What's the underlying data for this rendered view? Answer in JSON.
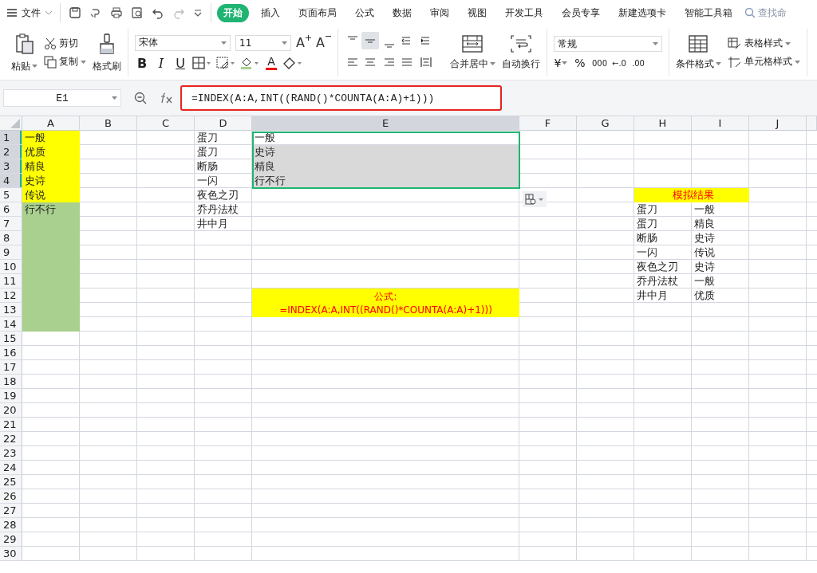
{
  "menu_bar": {
    "file": "文件",
    "tabs": [
      {
        "label": "开始",
        "selected": true
      },
      {
        "label": "插入",
        "selected": false
      },
      {
        "label": "页面布局",
        "selected": false
      },
      {
        "label": "公式",
        "selected": false
      },
      {
        "label": "数据",
        "selected": false
      },
      {
        "label": "审阅",
        "selected": false
      },
      {
        "label": "视图",
        "selected": false
      },
      {
        "label": "开发工具",
        "selected": false
      },
      {
        "label": "会员专享",
        "selected": false
      },
      {
        "label": "新建选项卡",
        "selected": false
      },
      {
        "label": "智能工具箱",
        "selected": false
      }
    ],
    "search": "查找命"
  },
  "ribbon": {
    "paste": "粘贴",
    "cut": "剪切",
    "copy": "复制",
    "format_painter": "格式刷",
    "font": "宋体",
    "size": "11",
    "grow_font": "A",
    "shrink_font": "A",
    "bold": "B",
    "italic": "I",
    "underline": "U",
    "font_color": "A",
    "merge_center": "合并居中",
    "wrap_text": "自动换行",
    "number_format": "常规",
    "currency": "¥",
    "percent": "%",
    "thousands": "000",
    "decimal_increase": "←.0",
    "decimal_decrease": ".00",
    "conditional_format": "条件格式",
    "table_style": "表格样式",
    "cell_style": "单元格样式"
  },
  "formula_bar": {
    "name_box": "E1",
    "formula": "=INDEX(A:A,INT((RAND()*COUNTA(A:A)+1)))"
  },
  "sheet": {
    "columns": [
      {
        "label": "A",
        "selected": false
      },
      {
        "label": "B",
        "selected": false
      },
      {
        "label": "C",
        "selected": false
      },
      {
        "label": "D",
        "selected": false
      },
      {
        "label": "E",
        "selected": true
      },
      {
        "label": "F",
        "selected": false
      },
      {
        "label": "G",
        "selected": false
      },
      {
        "label": "H",
        "selected": false
      },
      {
        "label": "I",
        "selected": false
      },
      {
        "label": "J",
        "selected": false
      }
    ],
    "rows": [
      {
        "label": "1",
        "selected": true,
        "cells": [
          {
            "text": "一般",
            "color": "#ffff00"
          },
          {},
          {},
          {
            "text": "蛋刀"
          },
          {
            "text": "一般",
            "selected": true,
            "active": true
          },
          {},
          {},
          {},
          {},
          {}
        ]
      },
      {
        "label": "2",
        "selected": true,
        "cells": [
          {
            "text": "优质",
            "color": "#ffff00"
          },
          {},
          {},
          {
            "text": "蛋刀"
          },
          {
            "text": "史诗",
            "selected": true,
            "active": false
          },
          {},
          {},
          {},
          {},
          {}
        ]
      },
      {
        "label": "3",
        "selected": true,
        "cells": [
          {
            "text": "精良",
            "color": "#ffff00"
          },
          {},
          {},
          {
            "text": "断肠"
          },
          {
            "text": "精良",
            "selected": true,
            "active": false
          },
          {},
          {},
          {},
          {},
          {}
        ]
      },
      {
        "label": "4",
        "selected": true,
        "cells": [
          {
            "text": "史诗",
            "color": "#ffff00"
          },
          {},
          {},
          {
            "text": "一闪"
          },
          {
            "text": "行不行",
            "selected": true,
            "active": false
          },
          {},
          {},
          {},
          {},
          {}
        ]
      },
      {
        "label": "5",
        "selected": false,
        "cells": [
          {
            "text": "传说",
            "color": "#ffff00"
          },
          {},
          {},
          {
            "text": "夜色之刃"
          },
          {},
          {},
          {},
          {
            "text": "模拟结果",
            "color": "#ffff00",
            "kind": "title-merged-across"
          },
          {}
        ]
      },
      {
        "label": "6",
        "selected": false,
        "cells": [
          {
            "text": "行不行",
            "color": "#a9d08e"
          },
          {},
          {},
          {
            "text": "乔丹法杖"
          },
          {},
          {},
          {},
          {
            "text": "蛋刀"
          },
          {
            "text": "一般"
          },
          {}
        ]
      },
      {
        "label": "7",
        "selected": false,
        "cells": [
          {
            "color": "#a9d08e"
          },
          {},
          {},
          {
            "text": "井中月"
          },
          {},
          {},
          {},
          {
            "text": "蛋刀"
          },
          {
            "text": "精良"
          },
          {}
        ]
      },
      {
        "label": "8",
        "selected": false,
        "cells": [
          {
            "color": "#a9d08e"
          },
          {},
          {},
          {},
          {},
          {},
          {},
          {
            "text": "断肠"
          },
          {
            "text": "史诗"
          },
          {}
        ]
      },
      {
        "label": "9",
        "selected": false,
        "cells": [
          {
            "color": "#a9d08e"
          },
          {},
          {},
          {},
          {},
          {},
          {},
          {
            "text": "一闪"
          },
          {
            "text": "传说"
          },
          {}
        ]
      },
      {
        "label": "10",
        "selected": false,
        "cells": [
          {
            "color": "#a9d08e"
          },
          {},
          {},
          {},
          {},
          {},
          {},
          {
            "text": "夜色之刃"
          },
          {
            "text": "史诗"
          },
          {}
        ]
      },
      {
        "label": "11",
        "selected": false,
        "cells": [
          {
            "color": "#a9d08e"
          },
          {},
          {},
          {},
          {},
          {},
          {},
          {
            "text": "乔丹法杖"
          },
          {
            "text": "一般"
          },
          {}
        ]
      },
      {
        "label": "12",
        "selected": false,
        "cells": [
          {
            "color": "#a9d08e"
          },
          {},
          {},
          {},
          {
            "lines": [
              "公式:",
              "=INDEX(A:A,INT((RAND()*COUNTA(A:A)+1)))"
            ],
            "color": "#ffff00",
            "kind": "note-merged-down"
          },
          {},
          {},
          {
            "text": "井中月"
          },
          {
            "text": "优质"
          },
          {}
        ]
      },
      {
        "label": "13",
        "selected": false,
        "cells": [
          {
            "color": "#a9d08e"
          },
          {},
          {},
          {},
          {},
          {},
          {},
          {},
          {}
        ]
      },
      {
        "label": "14",
        "selected": false,
        "cells": [
          {
            "color": "#a9d08e"
          },
          {},
          {},
          {},
          {},
          {},
          {},
          {},
          {},
          {}
        ]
      },
      {
        "label": "15",
        "selected": false
      },
      {
        "label": "16",
        "selected": false
      },
      {
        "label": "17",
        "selected": false
      },
      {
        "label": "18",
        "selected": false
      },
      {
        "label": "19",
        "selected": false
      },
      {
        "label": "20",
        "selected": false
      },
      {
        "label": "21",
        "selected": false
      },
      {
        "label": "22",
        "selected": false
      },
      {
        "label": "23",
        "selected": false
      },
      {
        "label": "24",
        "selected": false
      },
      {
        "label": "25",
        "selected": false
      },
      {
        "label": "26",
        "selected": false
      },
      {
        "label": "27",
        "selected": false
      },
      {
        "label": "28",
        "selected": false
      },
      {
        "label": "29",
        "selected": false
      },
      {
        "label": "30",
        "selected": false
      }
    ]
  }
}
